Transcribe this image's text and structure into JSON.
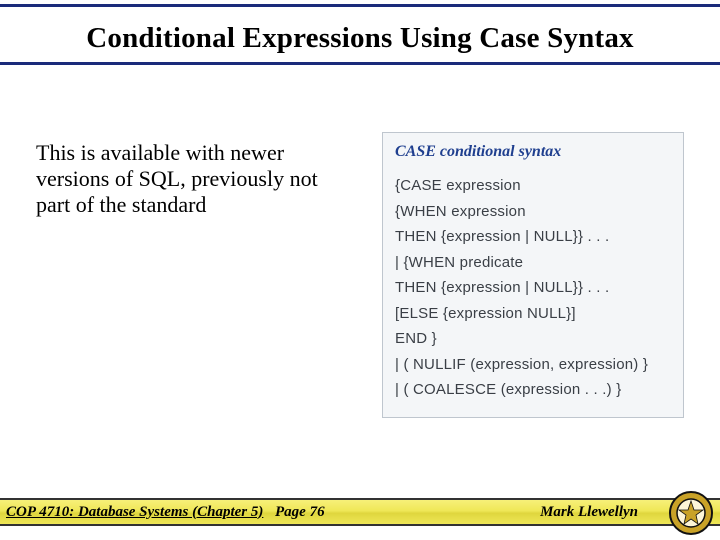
{
  "title": "Conditional Expressions Using Case Syntax",
  "bodyText": "This is available with newer versions of SQL, previously not part of the standard",
  "syntaxBox": {
    "title": "CASE conditional syntax",
    "lines": [
      "{CASE expression",
      "{WHEN expression",
      "THEN {expression | NULL}} . . .",
      "| {WHEN predicate",
      "THEN {expression | NULL}} . . .",
      "[ELSE {expression  NULL}]",
      "END }",
      "| ( NULLIF (expression, expression) }",
      "| ( COALESCE (expression . . .) }"
    ]
  },
  "footer": {
    "left": "COP 4710: Database Systems  (Chapter 5)",
    "center": "Page 76",
    "right": "Mark Llewellyn"
  }
}
